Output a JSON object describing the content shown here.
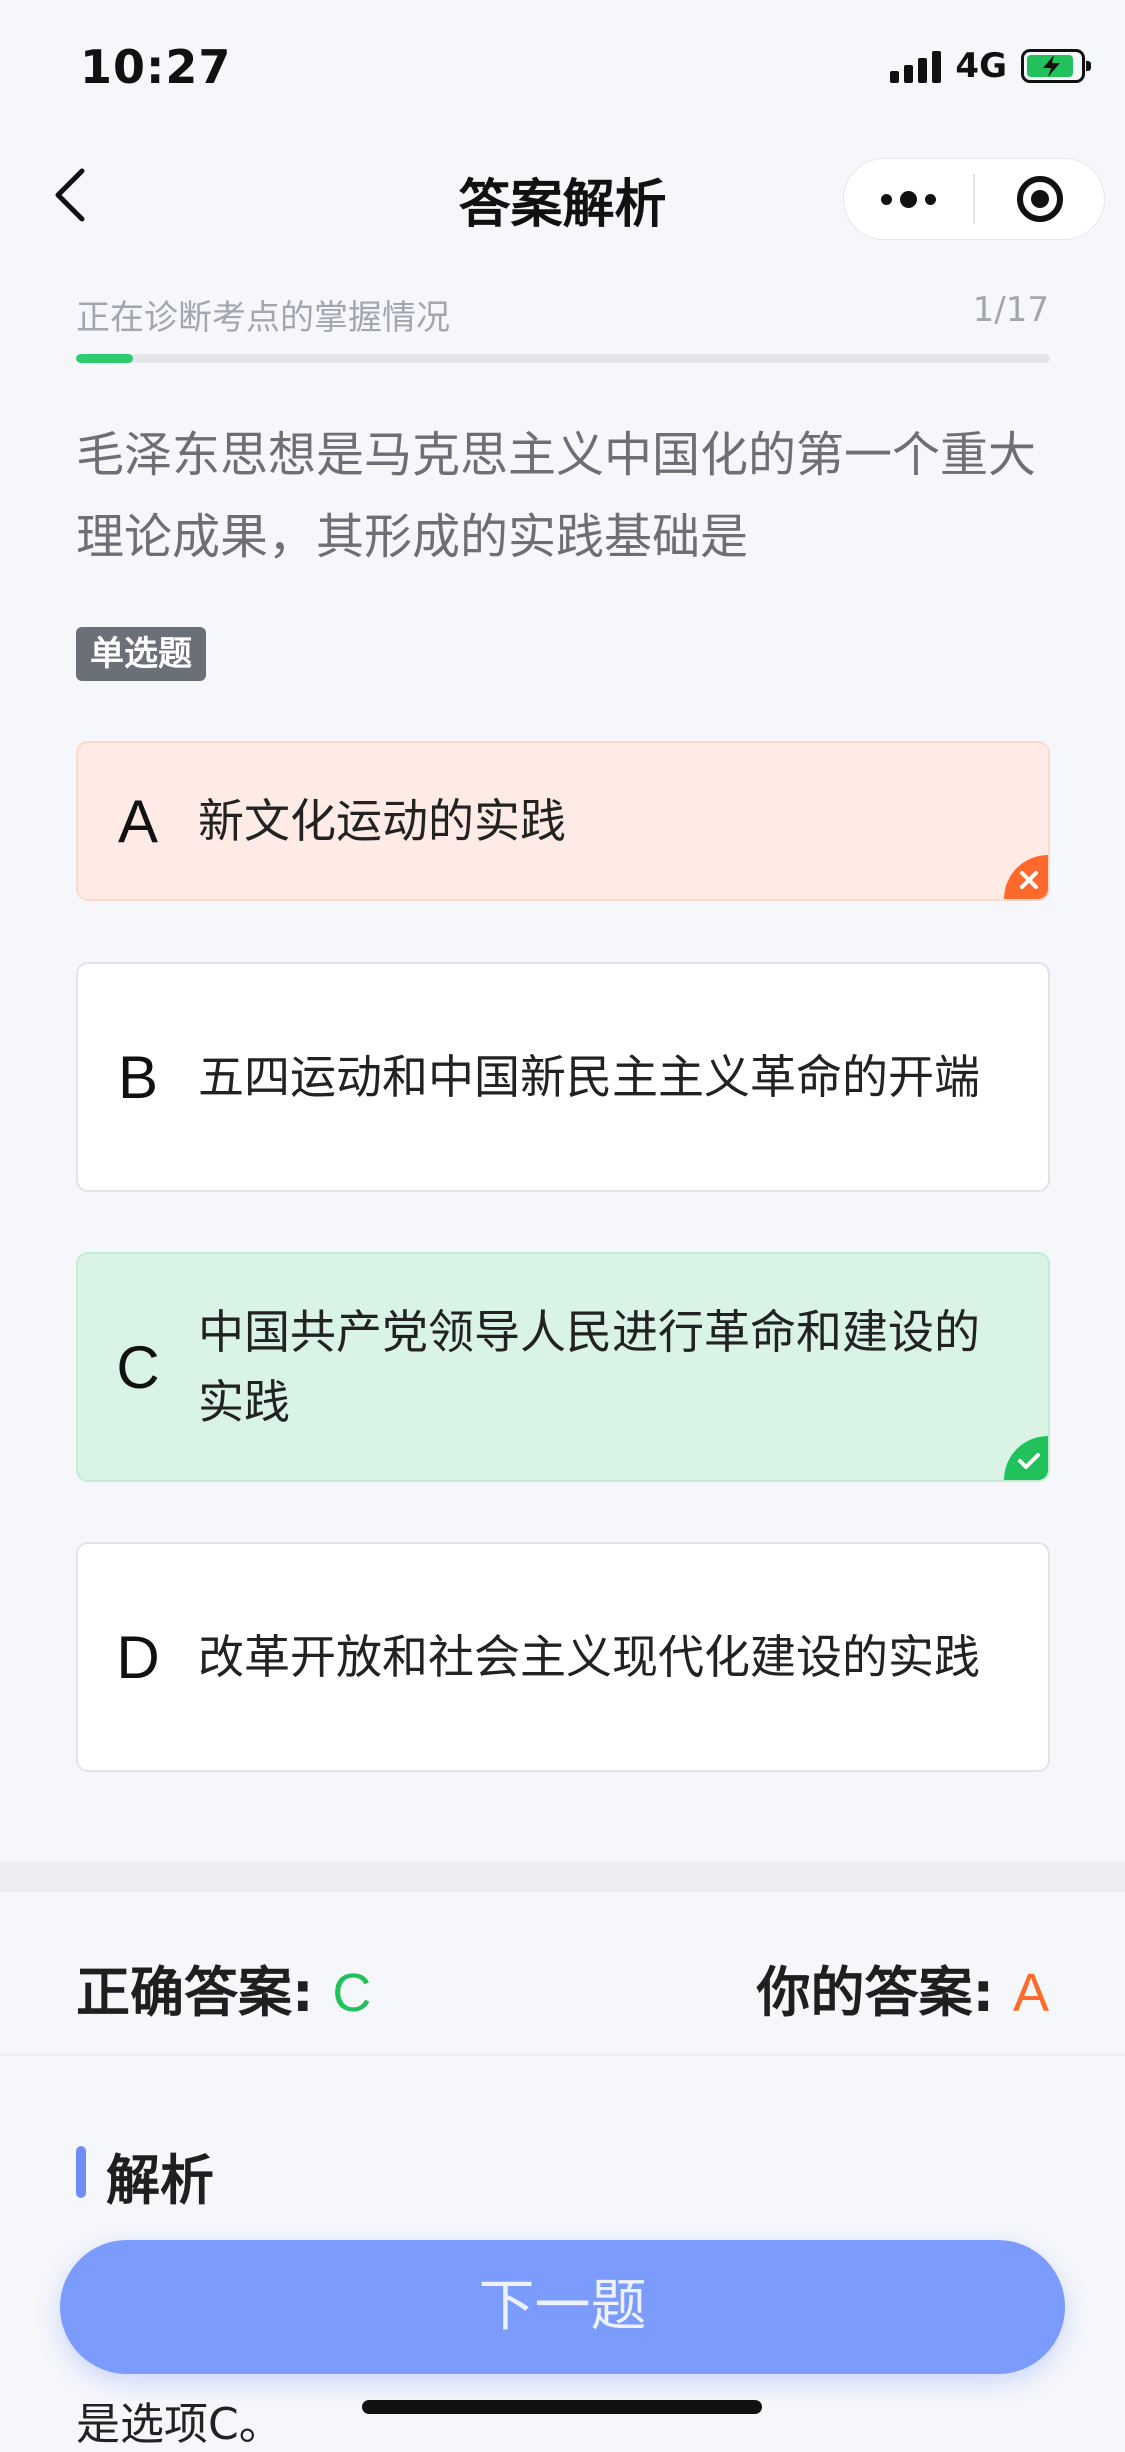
{
  "status_bar": {
    "time": "10:27",
    "network": "4G"
  },
  "nav": {
    "title": "答案解析"
  },
  "progress": {
    "label": "正在诊断考点的掌握情况",
    "count": "1/17",
    "current": 1,
    "total": 17
  },
  "question": {
    "text": "毛泽东思想是马克思主义中国化的第一个重大理论成果，其形成的实践基础是",
    "type": "单选题"
  },
  "options": [
    {
      "letter": "A",
      "text": "新文化运动的实践",
      "state": "wrong"
    },
    {
      "letter": "B",
      "text": "五四运动和中国新民主主义革命的开端",
      "state": "normal"
    },
    {
      "letter": "C",
      "text": "中国共产党领导人民进行革命和建设的实践",
      "state": "correct"
    },
    {
      "letter": "D",
      "text": "改革开放和社会主义现代化建设的实践",
      "state": "normal"
    }
  ],
  "answers": {
    "correct_label": "正确答案:",
    "correct_value": "C",
    "yours_label": "你的答案:",
    "yours_value": "A"
  },
  "analysis": {
    "title": "解析",
    "peek_text": "是选项C。"
  },
  "next_button": {
    "label": "下一题"
  },
  "colors": {
    "accent": "#7b9bfd",
    "correct": "#21c25b",
    "wrong": "#ff6a2c",
    "correct_bg": "#d9f4e6",
    "wrong_bg": "#ffebe5"
  }
}
